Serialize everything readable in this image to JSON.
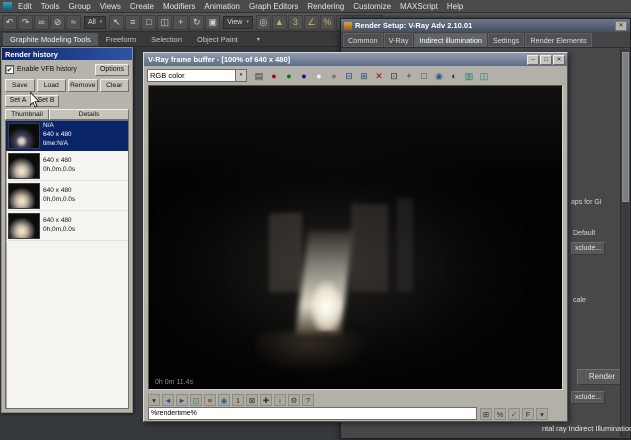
{
  "glyphs": {
    "check": "✔",
    "dropdown": "▾",
    "minimize": "–",
    "maximize": "□",
    "close": "✕",
    "ribbon_minimize": "▾"
  },
  "menubar": {
    "items": [
      "Edit",
      "Tools",
      "Group",
      "Views",
      "Create",
      "Modifiers",
      "Animation",
      "Graph Editors",
      "Rendering",
      "Customize",
      "MAXScript",
      "Help"
    ]
  },
  "toolbar": {
    "selection_filter_value": "All",
    "ref_coord_value": "View",
    "icons_a": [
      {
        "name": "undo-icon",
        "glyph": "↶",
        "color": "#ccd1d5"
      },
      {
        "name": "redo-icon",
        "glyph": "↷",
        "color": "#ccd1d5"
      },
      {
        "name": "select-and-link-icon",
        "glyph": "∞",
        "color": "#ccd1d5"
      },
      {
        "name": "unlink-selection-icon",
        "glyph": "⊘",
        "color": "#ccd1d5"
      },
      {
        "name": "bind-to-space-warp-icon",
        "glyph": "≈",
        "color": "#ccd1d5"
      }
    ],
    "icons_b": [
      {
        "name": "select-object-icon",
        "glyph": "↖",
        "color": "#d8dcdf"
      },
      {
        "name": "select-by-name-icon",
        "glyph": "≡",
        "color": "#ccd1d5"
      },
      {
        "name": "rectangular-selection-icon",
        "glyph": "□",
        "color": "#ccd1d5"
      },
      {
        "name": "window-crossing-icon",
        "glyph": "◫",
        "color": "#ccd1d5"
      },
      {
        "name": "select-and-move-icon",
        "glyph": "+",
        "color": "#ccd1d5"
      },
      {
        "name": "select-and-rotate-icon",
        "glyph": "↻",
        "color": "#ccd1d5"
      },
      {
        "name": "select-and-scale-icon",
        "glyph": "▣",
        "color": "#ccd1d5"
      }
    ],
    "icons_c": [
      {
        "name": "use-pivot-center-icon",
        "glyph": "◎",
        "color": "#ccd1d5"
      },
      {
        "name": "select-and-manipulate-icon",
        "glyph": "▲",
        "color": "#9fc46a"
      },
      {
        "name": "snap-toggle-3d-icon",
        "glyph": "3",
        "color": "#c8b060"
      },
      {
        "name": "angle-snap-icon",
        "glyph": "∠",
        "color": "#c8b060"
      },
      {
        "name": "percent-snap-icon",
        "glyph": "%",
        "color": "#c8b060"
      },
      {
        "name": "spinner-snap-icon",
        "glyph": "↕",
        "color": "#ccd1d5"
      },
      {
        "name": "mirror-icon",
        "glyph": "⋈",
        "color": "#ccd1d5"
      },
      {
        "name": "align-icon",
        "glyph": "▦",
        "color": "#ccd1d5"
      }
    ]
  },
  "ribbon": {
    "tabs": [
      "Graphite Modeling Tools",
      "Freeform",
      "Selection",
      "Object Paint"
    ]
  },
  "render_history": {
    "title": "Render history",
    "enable_label": "Enable VFB history",
    "options_label": "Options",
    "action_buttons": [
      "Save",
      "Load",
      "Remove",
      "Clear"
    ],
    "set_a_label": "Set A",
    "set_b_label": "Set B",
    "columns": [
      "Thumbnail",
      "Details"
    ],
    "rows": [
      {
        "name": "history-row-1",
        "selected": true,
        "line1": "N/A",
        "line2": "640 x 480",
        "line3": "time:N/A"
      },
      {
        "name": "history-row-2",
        "line1": "640 x 480",
        "line2": "0h,0m,0.0s"
      },
      {
        "name": "history-row-3",
        "line1": "640 x 480",
        "line2": "0h,0m,0.0s"
      },
      {
        "name": "history-row-4",
        "line1": "640 x 480",
        "line2": "0h,0m,0.0s"
      }
    ]
  },
  "vfb": {
    "title": "V-Ray frame buffer - [100% of 640 x 480]",
    "channel_value": "RGB color",
    "toolbar_icons": [
      {
        "name": "show-channels-icon",
        "glyph": "▤",
        "color": "#30343a"
      },
      {
        "name": "red-channel-icon",
        "glyph": "●",
        "color": "#8a1414"
      },
      {
        "name": "green-channel-icon",
        "glyph": "●",
        "color": "#157015"
      },
      {
        "name": "blue-channel-icon",
        "glyph": "●",
        "color": "#14148a"
      },
      {
        "name": "alpha-channel-icon",
        "glyph": "●",
        "color": "#f2f2f2"
      },
      {
        "name": "monochrome-icon",
        "glyph": "●",
        "color": "#777777"
      },
      {
        "name": "save-image-icon",
        "glyph": "⊟",
        "color": "#274a85"
      },
      {
        "name": "load-image-icon",
        "glyph": "⊞",
        "color": "#274a85"
      },
      {
        "name": "clear-image-icon",
        "glyph": "✕",
        "color": "#a01212"
      },
      {
        "name": "duplicate-to-max-icon",
        "glyph": "⊡",
        "color": "#333333"
      },
      {
        "name": "track-mouse-icon",
        "glyph": "+",
        "color": "#333333"
      },
      {
        "name": "region-render-icon",
        "glyph": "□",
        "color": "#333333"
      },
      {
        "name": "pixel-info-icon",
        "glyph": "◉",
        "color": "#24608a"
      },
      {
        "name": "color-correction-icon",
        "glyph": "◐",
        "color": "#333333"
      },
      {
        "name": "stereo-icon",
        "glyph": "▥",
        "color": "#1e7a7a"
      },
      {
        "name": "compare-icon",
        "glyph": "◫",
        "color": "#1e7a7a"
      }
    ],
    "render_time": "0h 0m 11.4s",
    "bottom_icons": [
      {
        "name": "stamp-toggle-icon",
        "glyph": "▾",
        "color": "#333333"
      },
      {
        "name": "prev-image-icon",
        "glyph": "◄",
        "color": "#27508a"
      },
      {
        "name": "next-image-icon",
        "glyph": "►",
        "color": "#27508a"
      },
      {
        "name": "compare-ab-icon",
        "glyph": "◫",
        "color": "#1e7a7a"
      },
      {
        "name": "history-list-icon",
        "glyph": "≡",
        "color": "#333333"
      },
      {
        "name": "magnify-icon",
        "glyph": "◉",
        "color": "#24608a"
      },
      {
        "name": "one-to-one-icon",
        "glyph": "1",
        "color": "#333333"
      },
      {
        "name": "fit-view-icon",
        "glyph": "⊠",
        "color": "#333333"
      },
      {
        "name": "pan-icon",
        "glyph": "✚",
        "color": "#333333"
      },
      {
        "name": "pixel-probe-icon",
        "glyph": "i",
        "color": "#24608a"
      },
      {
        "name": "settings-icon",
        "glyph": "⚙",
        "color": "#333333"
      },
      {
        "name": "help-icon",
        "glyph": "?",
        "color": "#333333"
      }
    ],
    "stamp_value": "%rendertime%",
    "stamp_icons": [
      {
        "name": "stamp-variables-icon",
        "glyph": "⊞",
        "color": "#333333"
      },
      {
        "name": "stamp-percent-icon",
        "glyph": "%",
        "color": "#333333"
      },
      {
        "name": "stamp-apply-icon",
        "glyph": "✓",
        "color": "#1c6e1c"
      },
      {
        "name": "stamp-font-icon",
        "glyph": "F",
        "color": "#333333"
      },
      {
        "name": "stamp-position-icon",
        "glyph": "▾",
        "color": "#333333"
      }
    ]
  },
  "render_setup": {
    "title": "Render Setup: V-Ray Adv 2.10.01",
    "tabs": [
      "Common",
      "V-Ray",
      "Indirect illumination",
      "Settings",
      "Render Elements"
    ],
    "fragments": {
      "gi_caption": "aps for GI",
      "default_value": "Default",
      "exclude_top": "xclude...",
      "scale_label": "cale",
      "exclude_bottom": "xclude..."
    },
    "render_button_label": "Render"
  },
  "status": {
    "renderer_hint": "ntal ray Indirect Illumination"
  }
}
